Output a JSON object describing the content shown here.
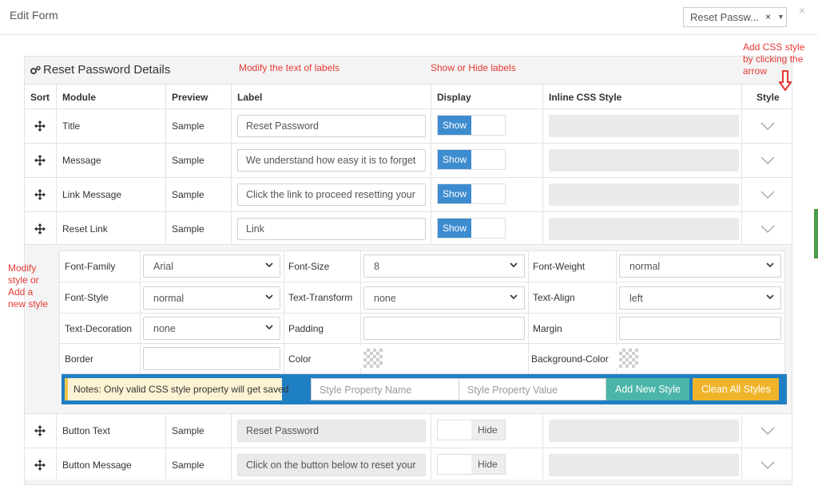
{
  "modal": {
    "title": "Edit Form",
    "form_select": {
      "value": "Reset Passw...",
      "clear": "×",
      "caret": "▼"
    },
    "close": "×"
  },
  "panel": {
    "title": "Reset Password Details"
  },
  "annotations": {
    "labels": "Modify the text of labels",
    "display": "Show or Hide labels",
    "css": [
      "Add CSS style",
      "by clicking the",
      "arrow"
    ],
    "style": [
      "Modify",
      "style or",
      "Add a",
      "new style"
    ]
  },
  "columns": {
    "sort": "Sort",
    "module": "Module",
    "preview": "Preview",
    "label": "Label",
    "display": "Display",
    "inline_css": "Inline CSS Style",
    "style": "Style"
  },
  "rows": [
    {
      "module": "Title",
      "preview": "Sample",
      "label": "Reset Password",
      "display": "Show"
    },
    {
      "module": "Message",
      "preview": "Sample",
      "label": "We understand how easy it is to forget",
      "display": "Show"
    },
    {
      "module": "Link Message",
      "preview": "Sample",
      "label": "Click the link to proceed resetting your",
      "display": "Show"
    },
    {
      "module": "Reset Link",
      "preview": "Sample",
      "label": "Link",
      "display": "Show"
    },
    {
      "module": "Button Text",
      "preview": "Sample",
      "label": "Reset Password",
      "display": "Hide"
    },
    {
      "module": "Button Message",
      "preview": "Sample",
      "label": "Click on the button below to reset your",
      "display": "Hide"
    }
  ],
  "style_editor": {
    "font_family": {
      "label": "Font-Family",
      "value": "Arial"
    },
    "font_size": {
      "label": "Font-Size",
      "value": "8"
    },
    "font_weight": {
      "label": "Font-Weight",
      "value": "normal"
    },
    "font_style": {
      "label": "Font-Style",
      "value": "normal"
    },
    "text_transform": {
      "label": "Text-Transform",
      "value": "none"
    },
    "text_align": {
      "label": "Text-Align",
      "value": "left"
    },
    "text_decoration": {
      "label": "Text-Decoration",
      "value": "none"
    },
    "padding": {
      "label": "Padding",
      "value": ""
    },
    "margin": {
      "label": "Margin",
      "value": ""
    },
    "border": {
      "label": "Border",
      "value": ""
    },
    "color": {
      "label": "Color"
    },
    "background_color": {
      "label": "Background-Color"
    },
    "note": "Notes: Only valid CSS style property will get saved",
    "prop_name_placeholder": "Style Property Name",
    "prop_value_placeholder": "Style Property Value",
    "add_button": "Add New Style",
    "clean_button": "Clean All Styles"
  },
  "colors": {
    "show_toggle": "#3d8ccf",
    "toolbar": "#1f7fc3",
    "add_button": "#4ab5a8",
    "clean_button": "#f0b42b",
    "annotation": "#e53935"
  }
}
